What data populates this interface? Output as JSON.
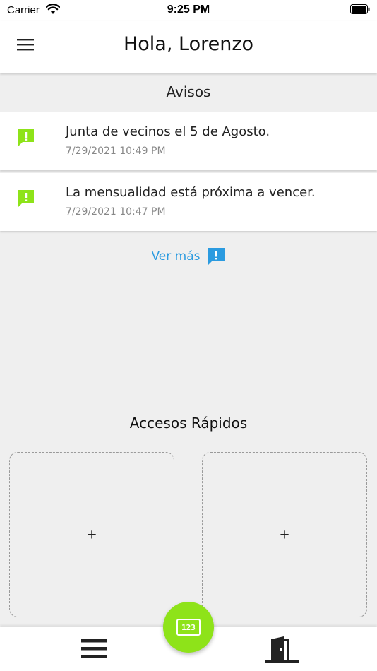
{
  "status_bar": {
    "carrier": "Carrier",
    "time": "9:25 PM"
  },
  "header": {
    "title": "Hola, Lorenzo"
  },
  "avisos": {
    "title": "Avisos",
    "items": [
      {
        "text": "Junta de vecinos el 5 de Agosto.",
        "date": "7/29/2021 10:49 PM"
      },
      {
        "text": "La mensualidad está próxima a vencer.",
        "date": "7/29/2021 10:47 PM"
      }
    ],
    "see_more_label": "Ver más"
  },
  "accesos": {
    "title": "Accesos Rápidos",
    "tiles": [
      {
        "symbol": "+"
      },
      {
        "symbol": "+"
      }
    ]
  },
  "bottom_nav": {
    "fab_label": "123"
  },
  "colors": {
    "accent_green": "#8ee319",
    "link_blue": "#2b9be0",
    "notice_icon_green": "#8ee319"
  },
  "icons": {
    "menu": "hamburger-menu-icon",
    "notice": "feedback-alert-icon",
    "see_more": "feedback-alert-icon",
    "bottom_menu": "hamburger-menu-icon",
    "fab": "dialpad-123-icon",
    "exit": "door-exit-icon"
  }
}
